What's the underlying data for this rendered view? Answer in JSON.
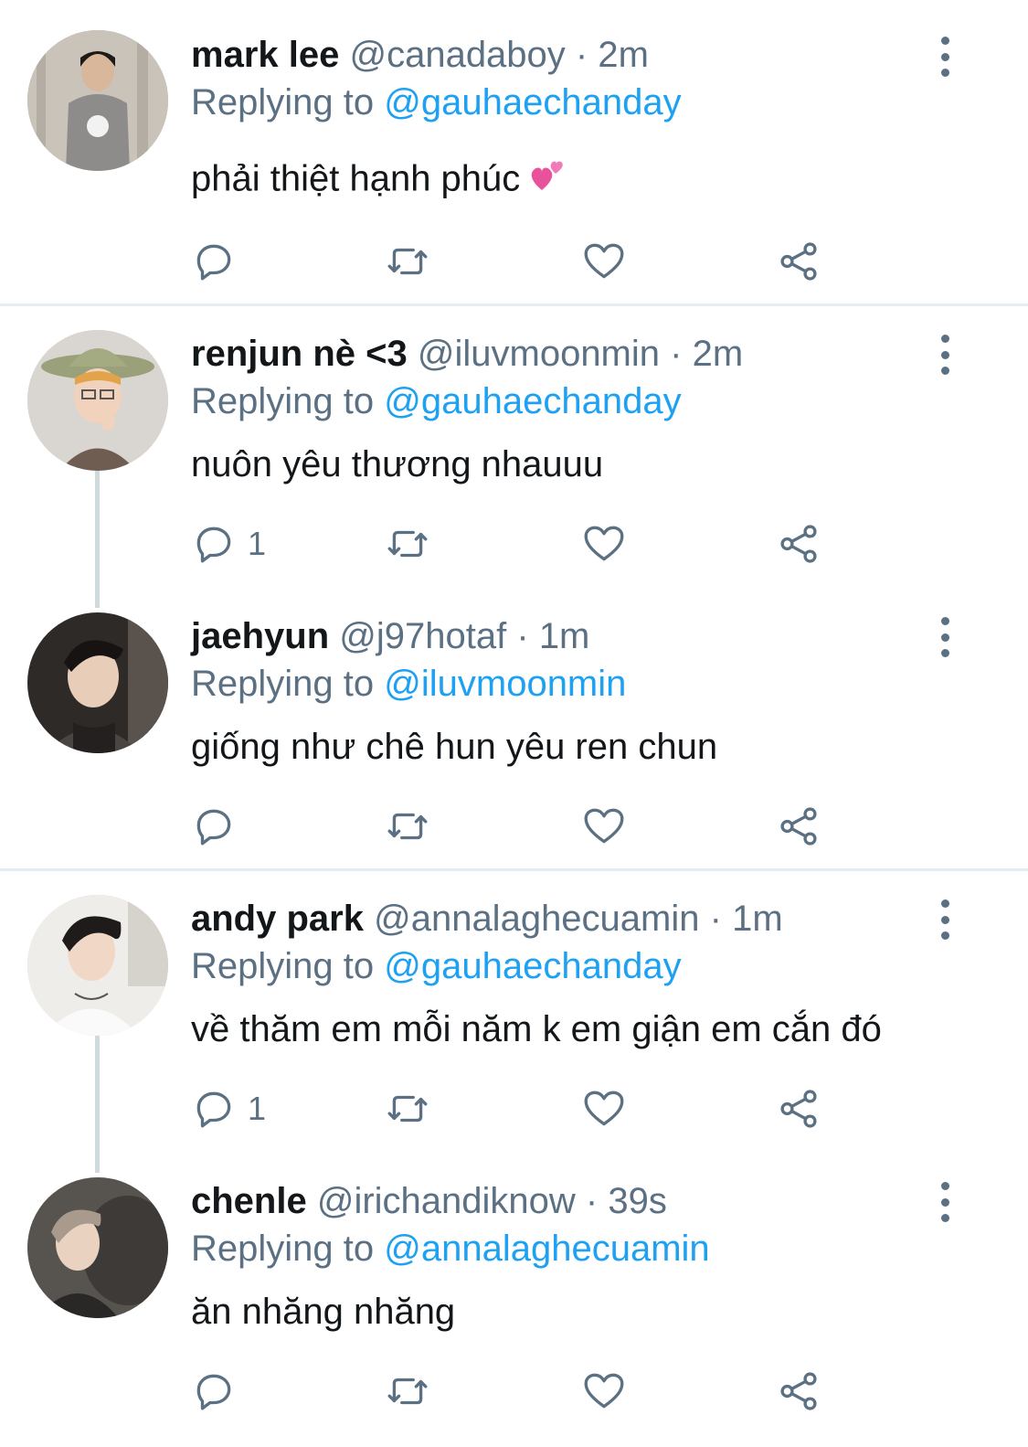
{
  "tweets": [
    {
      "name": "mark lee",
      "handle": "@canadaboy",
      "time": "2m",
      "replying_label": "Replying to",
      "replying_to": "@gauhaechanday",
      "text": "phải thiệt hạnh phúc",
      "emoji": "two-hearts-icon",
      "reply_count": "",
      "avatar_color": "#b9b4ad"
    },
    {
      "name": "renjun nè <3",
      "handle": "@iluvmoonmin",
      "time": "2m",
      "replying_label": "Replying to",
      "replying_to": "@gauhaechanday",
      "text": "nuôn yêu thương nhauuu",
      "reply_count": "1",
      "avatar_color": "#d8d4cf"
    },
    {
      "name": "jaehyun",
      "handle": "@j97hotaf",
      "time": "1m",
      "replying_label": "Replying to",
      "replying_to": "@iluvmoonmin",
      "text": "giống như chê hun yêu ren chun",
      "reply_count": "",
      "avatar_color": "#3a3330"
    },
    {
      "name": "andy park",
      "handle": "@annalaghecuamin",
      "time": "1m",
      "replying_label": "Replying to",
      "replying_to": "@gauhaechanday",
      "text": "về thăm em mỗi năm k em giận em cắn đó",
      "reply_count": "1",
      "avatar_color": "#e9e7e4"
    },
    {
      "name": "chenle",
      "handle": "@irichandiknow",
      "time": "39s",
      "replying_label": "Replying to",
      "replying_to": "@annalaghecuamin",
      "text": "ăn nhăng nhăng",
      "reply_count": "",
      "avatar_color": "#4a4744"
    }
  ],
  "colors": {
    "accent": "#1da1f2",
    "secondary_text": "#5b7083",
    "divider": "#e6ecf0"
  }
}
